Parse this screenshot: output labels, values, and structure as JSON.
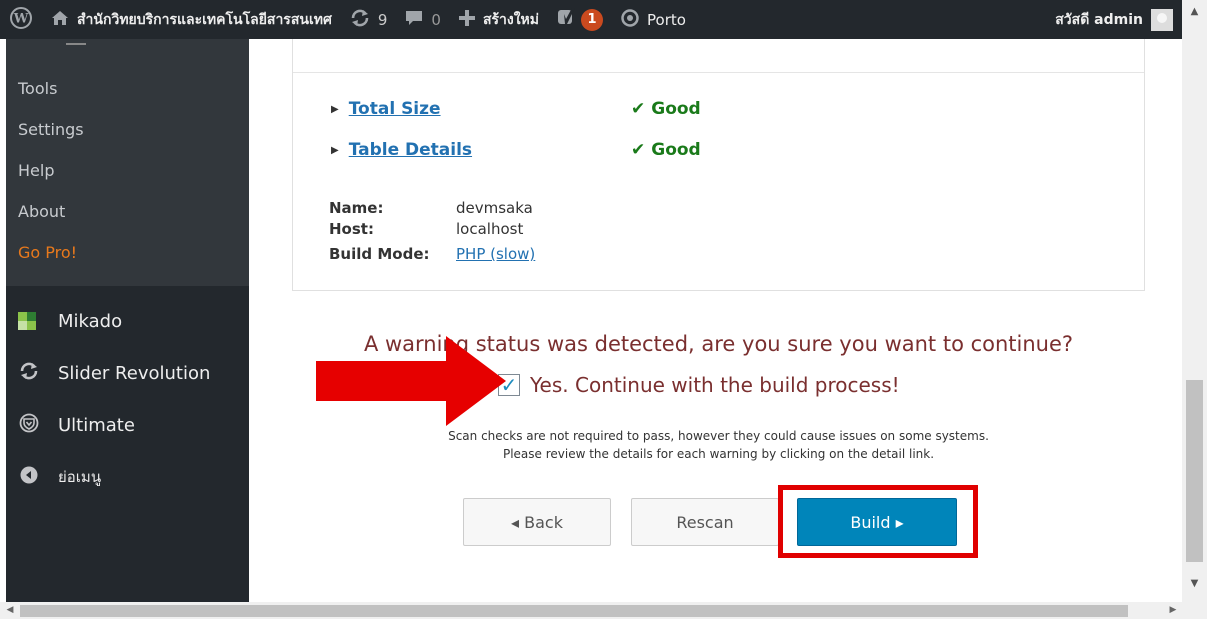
{
  "adminbar": {
    "wp_logo_icon": "wordpress-logo-icon",
    "site_icon": "home-icon",
    "site_name": "สำนักวิทยบริการและเทคโนโลยีสารสนเทศ",
    "updates_icon": "refresh-icon",
    "updates_count": "9",
    "comments_icon": "comment-icon",
    "comments_count": "0",
    "new_icon": "plus-icon",
    "new_label": "สร้างใหม่",
    "yoast_icon": "yoast-icon",
    "yoast_badge": "1",
    "theme_icon": "circle-dot-icon",
    "theme_label": "Porto",
    "greeting": "สวัสดี admin"
  },
  "sidebar": {
    "submenu": [
      {
        "label": "Tools"
      },
      {
        "label": "Settings"
      },
      {
        "label": "Help"
      },
      {
        "label": "About"
      },
      {
        "label": "Go Pro!"
      }
    ],
    "menu": [
      {
        "label": "Mikado",
        "icon": "mikado-icon"
      },
      {
        "label": "Slider Revolution",
        "icon": "refresh-icon"
      },
      {
        "label": "Ultimate",
        "icon": "shield-icon"
      },
      {
        "label": "ย่อเมนู",
        "icon": "collapse-icon"
      }
    ]
  },
  "checks": [
    {
      "label": "Total Size",
      "status": "Good"
    },
    {
      "label": "Table Details",
      "status": "Good"
    }
  ],
  "database": {
    "name_label": "Name:",
    "name_value": "devmsaka",
    "host_label": "Host:",
    "host_value": "localhost",
    "mode_label": "Build Mode:",
    "mode_value": "PHP (slow)"
  },
  "warning": {
    "message": "A warning status was detected, are you sure you want to continue?",
    "confirm_label": "Yes. Continue with the build process!",
    "confirm_checked": true,
    "note_line1": "Scan checks are not required to pass, however they could cause issues on some systems.",
    "note_line2": "Please review the details for each warning by clicking on the detail link."
  },
  "buttons": {
    "back": "◂ Back",
    "rescan": "Rescan",
    "build": "Build ▸"
  },
  "colors": {
    "adminbar_bg": "#23282d",
    "build_button": "#0085ba",
    "highlight": "#e00000",
    "warning_text": "#7a2f2f",
    "good_status": "#1a7a1a",
    "go_pro": "#e8791c"
  }
}
